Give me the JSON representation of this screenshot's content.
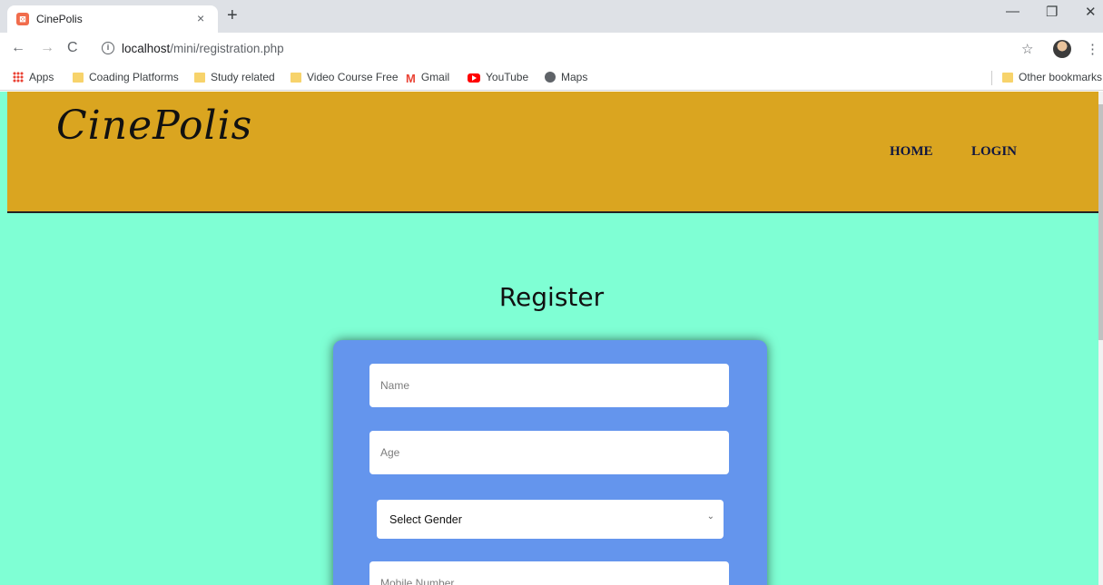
{
  "browser": {
    "tab_title": "CinePolis",
    "tab_close": "×",
    "new_tab": "+",
    "url_host": "localhost",
    "url_path": "/mini/registration.php",
    "window_controls": {
      "minimize": "—",
      "restore": "❐",
      "close": "✕"
    },
    "nav": {
      "back": "←",
      "forward": "→",
      "reload": "C"
    },
    "bookmarks": [
      {
        "label": "Apps",
        "icon": "apps-grid-icon"
      },
      {
        "label": "Coading Platforms",
        "icon": "folder-icon"
      },
      {
        "label": "Study related",
        "icon": "folder-icon"
      },
      {
        "label": "Video Course Free",
        "icon": "folder-icon"
      },
      {
        "label": "Gmail",
        "icon": "gmail-icon"
      },
      {
        "label": "YouTube",
        "icon": "youtube-icon"
      },
      {
        "label": "Maps",
        "icon": "maps-icon"
      }
    ],
    "other_bookmarks": "Other bookmarks"
  },
  "site": {
    "logo": "CinePolis",
    "nav": {
      "home": "HOME",
      "login": "LOGIN"
    },
    "colors": {
      "header": "#daa520",
      "background": "#7fffd4",
      "card": "#6495ed"
    }
  },
  "form": {
    "title": "Register",
    "name_placeholder": "Name",
    "age_placeholder": "Age",
    "gender_selected": "Select Gender",
    "mobile_placeholder": "Mobile Number"
  }
}
